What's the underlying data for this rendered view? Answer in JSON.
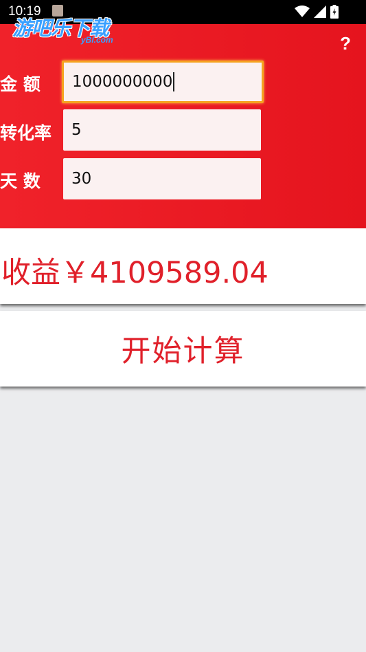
{
  "status_bar": {
    "time": "10:19",
    "icons": [
      "wifi-icon",
      "signal-icon",
      "battery-icon"
    ]
  },
  "watermark": {
    "main": "游吧乐下载",
    "sub": "yBl.com"
  },
  "header": {
    "help": "?",
    "amount_label": "金 额",
    "amount_value": "1000000000",
    "rate_label": "转化率",
    "rate_value": "5",
    "days_label": "天 数",
    "days_value": "30"
  },
  "result": {
    "text": "收益￥4109589.04"
  },
  "calculate": {
    "label": "开始计算"
  },
  "colors": {
    "header_red": "#e8161f",
    "accent_red": "#e0202a",
    "focus_orange": "#f5a320",
    "background": "#ebecee"
  }
}
